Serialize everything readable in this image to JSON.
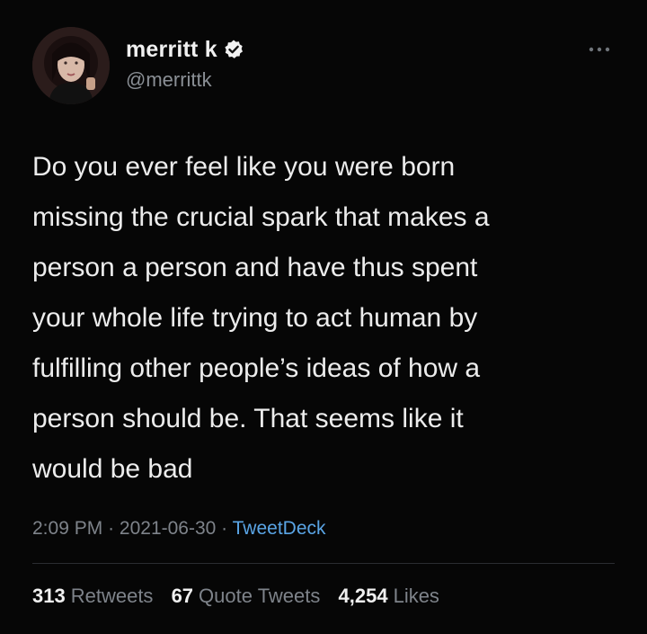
{
  "author": {
    "display_name": "merritt k",
    "handle": "@merrittk",
    "verified": true,
    "avatar_icon": "profile-photo"
  },
  "tweet": {
    "text": "Do you ever feel like you were born\nmissing the crucial spark that makes a\nperson a person and have thus spent\nyour whole life trying to act human by\nfulfilling other people’s ideas of how a\nperson should be. That seems like it\nwould be bad",
    "time": "2:09 PM",
    "date": "2021-06-30",
    "separator": "·",
    "source": "TweetDeck"
  },
  "stats": {
    "retweets": {
      "count": "313",
      "label": "Retweets"
    },
    "quote_tweets": {
      "count": "67",
      "label": "Quote Tweets"
    },
    "likes": {
      "count": "4,254",
      "label": "Likes"
    }
  },
  "icons": {
    "verified": "verified-badge-icon",
    "more": "more-options-icon"
  },
  "colors": {
    "background": "#060606",
    "text": "#ececec",
    "muted": "#7e838a",
    "link": "#5aa5e6"
  }
}
